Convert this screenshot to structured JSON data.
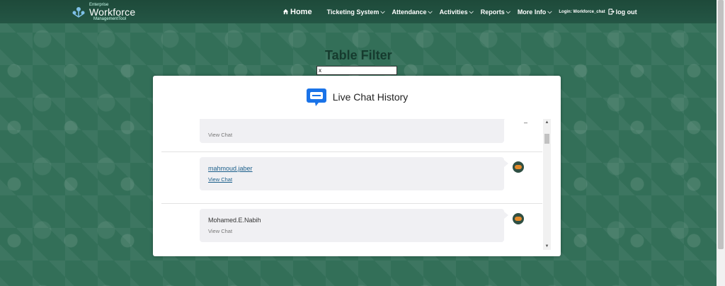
{
  "brand": {
    "small_top": "Enterprise",
    "name": "Workforce",
    "small_bottom": "ManagementTool"
  },
  "nav": {
    "home": "Home",
    "ticketing": "Ticketing System",
    "attendance": "Attendance",
    "activities": "Activities",
    "reports": "Reports",
    "more_info": "More Info",
    "login": "Login: Workforce_chat",
    "logout": "log out"
  },
  "filter": {
    "title": "Table Filter",
    "value": "x"
  },
  "modal": {
    "title": "Live Chat History"
  },
  "chats": [
    {
      "agent": "",
      "view_label": "View Chat"
    },
    {
      "agent": "mahmoud.jaber",
      "view_label": "View Chat"
    },
    {
      "agent": "Mohamed.E.Nabih",
      "view_label": "View Chat"
    }
  ],
  "colors": {
    "navbar": "#1e4a3a",
    "background": "#336f58",
    "accent": "#1a73e8",
    "avatar": "#2f4f43"
  }
}
